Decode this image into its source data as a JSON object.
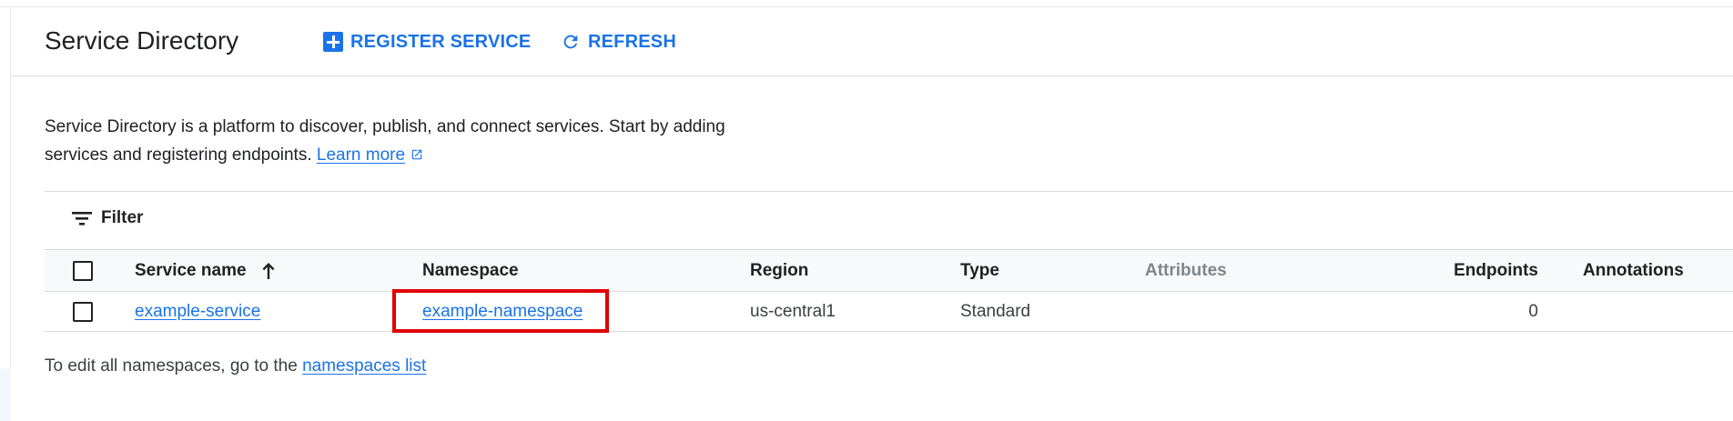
{
  "header": {
    "title": "Service Directory",
    "register_label": "REGISTER SERVICE",
    "refresh_label": "REFRESH"
  },
  "description": {
    "line1": "Service Directory is a platform to discover, publish, and connect services. Start by adding",
    "line2": "services and registering endpoints.",
    "learn_more": "Learn more"
  },
  "filter": {
    "label": "Filter"
  },
  "table": {
    "columns": {
      "service_name": "Service name",
      "namespace": "Namespace",
      "region": "Region",
      "type": "Type",
      "attributes": "Attributes",
      "endpoints": "Endpoints",
      "annotations": "Annotations"
    },
    "sort": {
      "column": "Service name",
      "direction": "ascending"
    },
    "rows": [
      {
        "service_name": "example-service",
        "namespace": "example-namespace",
        "region": "us-central1",
        "type": "Standard",
        "attributes": "",
        "endpoints": "0",
        "annotations": ""
      }
    ]
  },
  "footer": {
    "text": "To edit all namespaces, go to the",
    "link": "namespaces list"
  },
  "colors": {
    "accent": "#1a73e8",
    "highlight": "#e00000",
    "header_bg": "#f8f9fa",
    "divider": "#dadce0"
  },
  "icons": {
    "register": "add-box-icon",
    "refresh": "refresh-icon",
    "external": "open-in-new-icon",
    "filter": "filter-list-icon",
    "sort": "arrow-upward-icon"
  }
}
